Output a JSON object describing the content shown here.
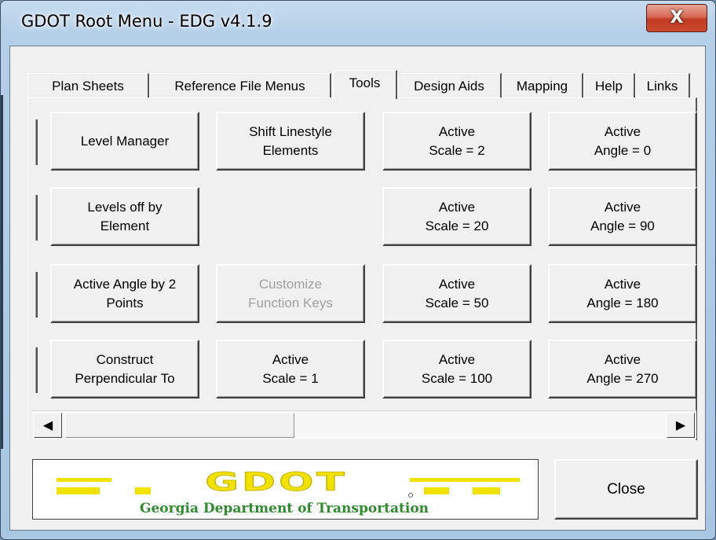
{
  "window": {
    "title": "GDOT Root Menu - EDG v4.1.9",
    "close_glyph": "X"
  },
  "tabs": [
    {
      "label": "Plan Sheets",
      "active": false
    },
    {
      "label": "Reference File Menus",
      "active": false
    },
    {
      "label": "Tools",
      "active": true
    },
    {
      "label": "Design Aids",
      "active": false
    },
    {
      "label": "Mapping",
      "active": false
    },
    {
      "label": "Help",
      "active": false
    },
    {
      "label": "Links",
      "active": false
    }
  ],
  "tools": {
    "level_manager": "Level Manager",
    "shift_linestyle": "Shift Linestyle\nElements",
    "scale_2": "Active\nScale = 2",
    "angle_0": "Active\nAngle = 0",
    "levels_off": "Levels off by\nElement",
    "scale_20": "Active\nScale = 20",
    "angle_90": "Active\nAngle = 90",
    "angle_by_2pts": "Active Angle by 2\nPoints",
    "customize_keys": "Customize\nFunction Keys",
    "scale_50": "Active\nScale = 50",
    "angle_180": "Active\nAngle = 180",
    "construct_perp": "Construct\nPerpendicular To",
    "scale_1": "Active\nScale = 1",
    "scale_100": "Active\nScale = 100",
    "angle_270": "Active\nAngle = 270"
  },
  "scrollbar": {
    "left_glyph": "◀",
    "right_glyph": "▶"
  },
  "logo": {
    "wordmark": "GDOT",
    "org_name": "Georgia Department of Transportation",
    "colors": {
      "yellow": "#f2e200",
      "gold": "#d8c200",
      "green": "#2e8b2e"
    }
  },
  "footer": {
    "close_label": "Close"
  }
}
